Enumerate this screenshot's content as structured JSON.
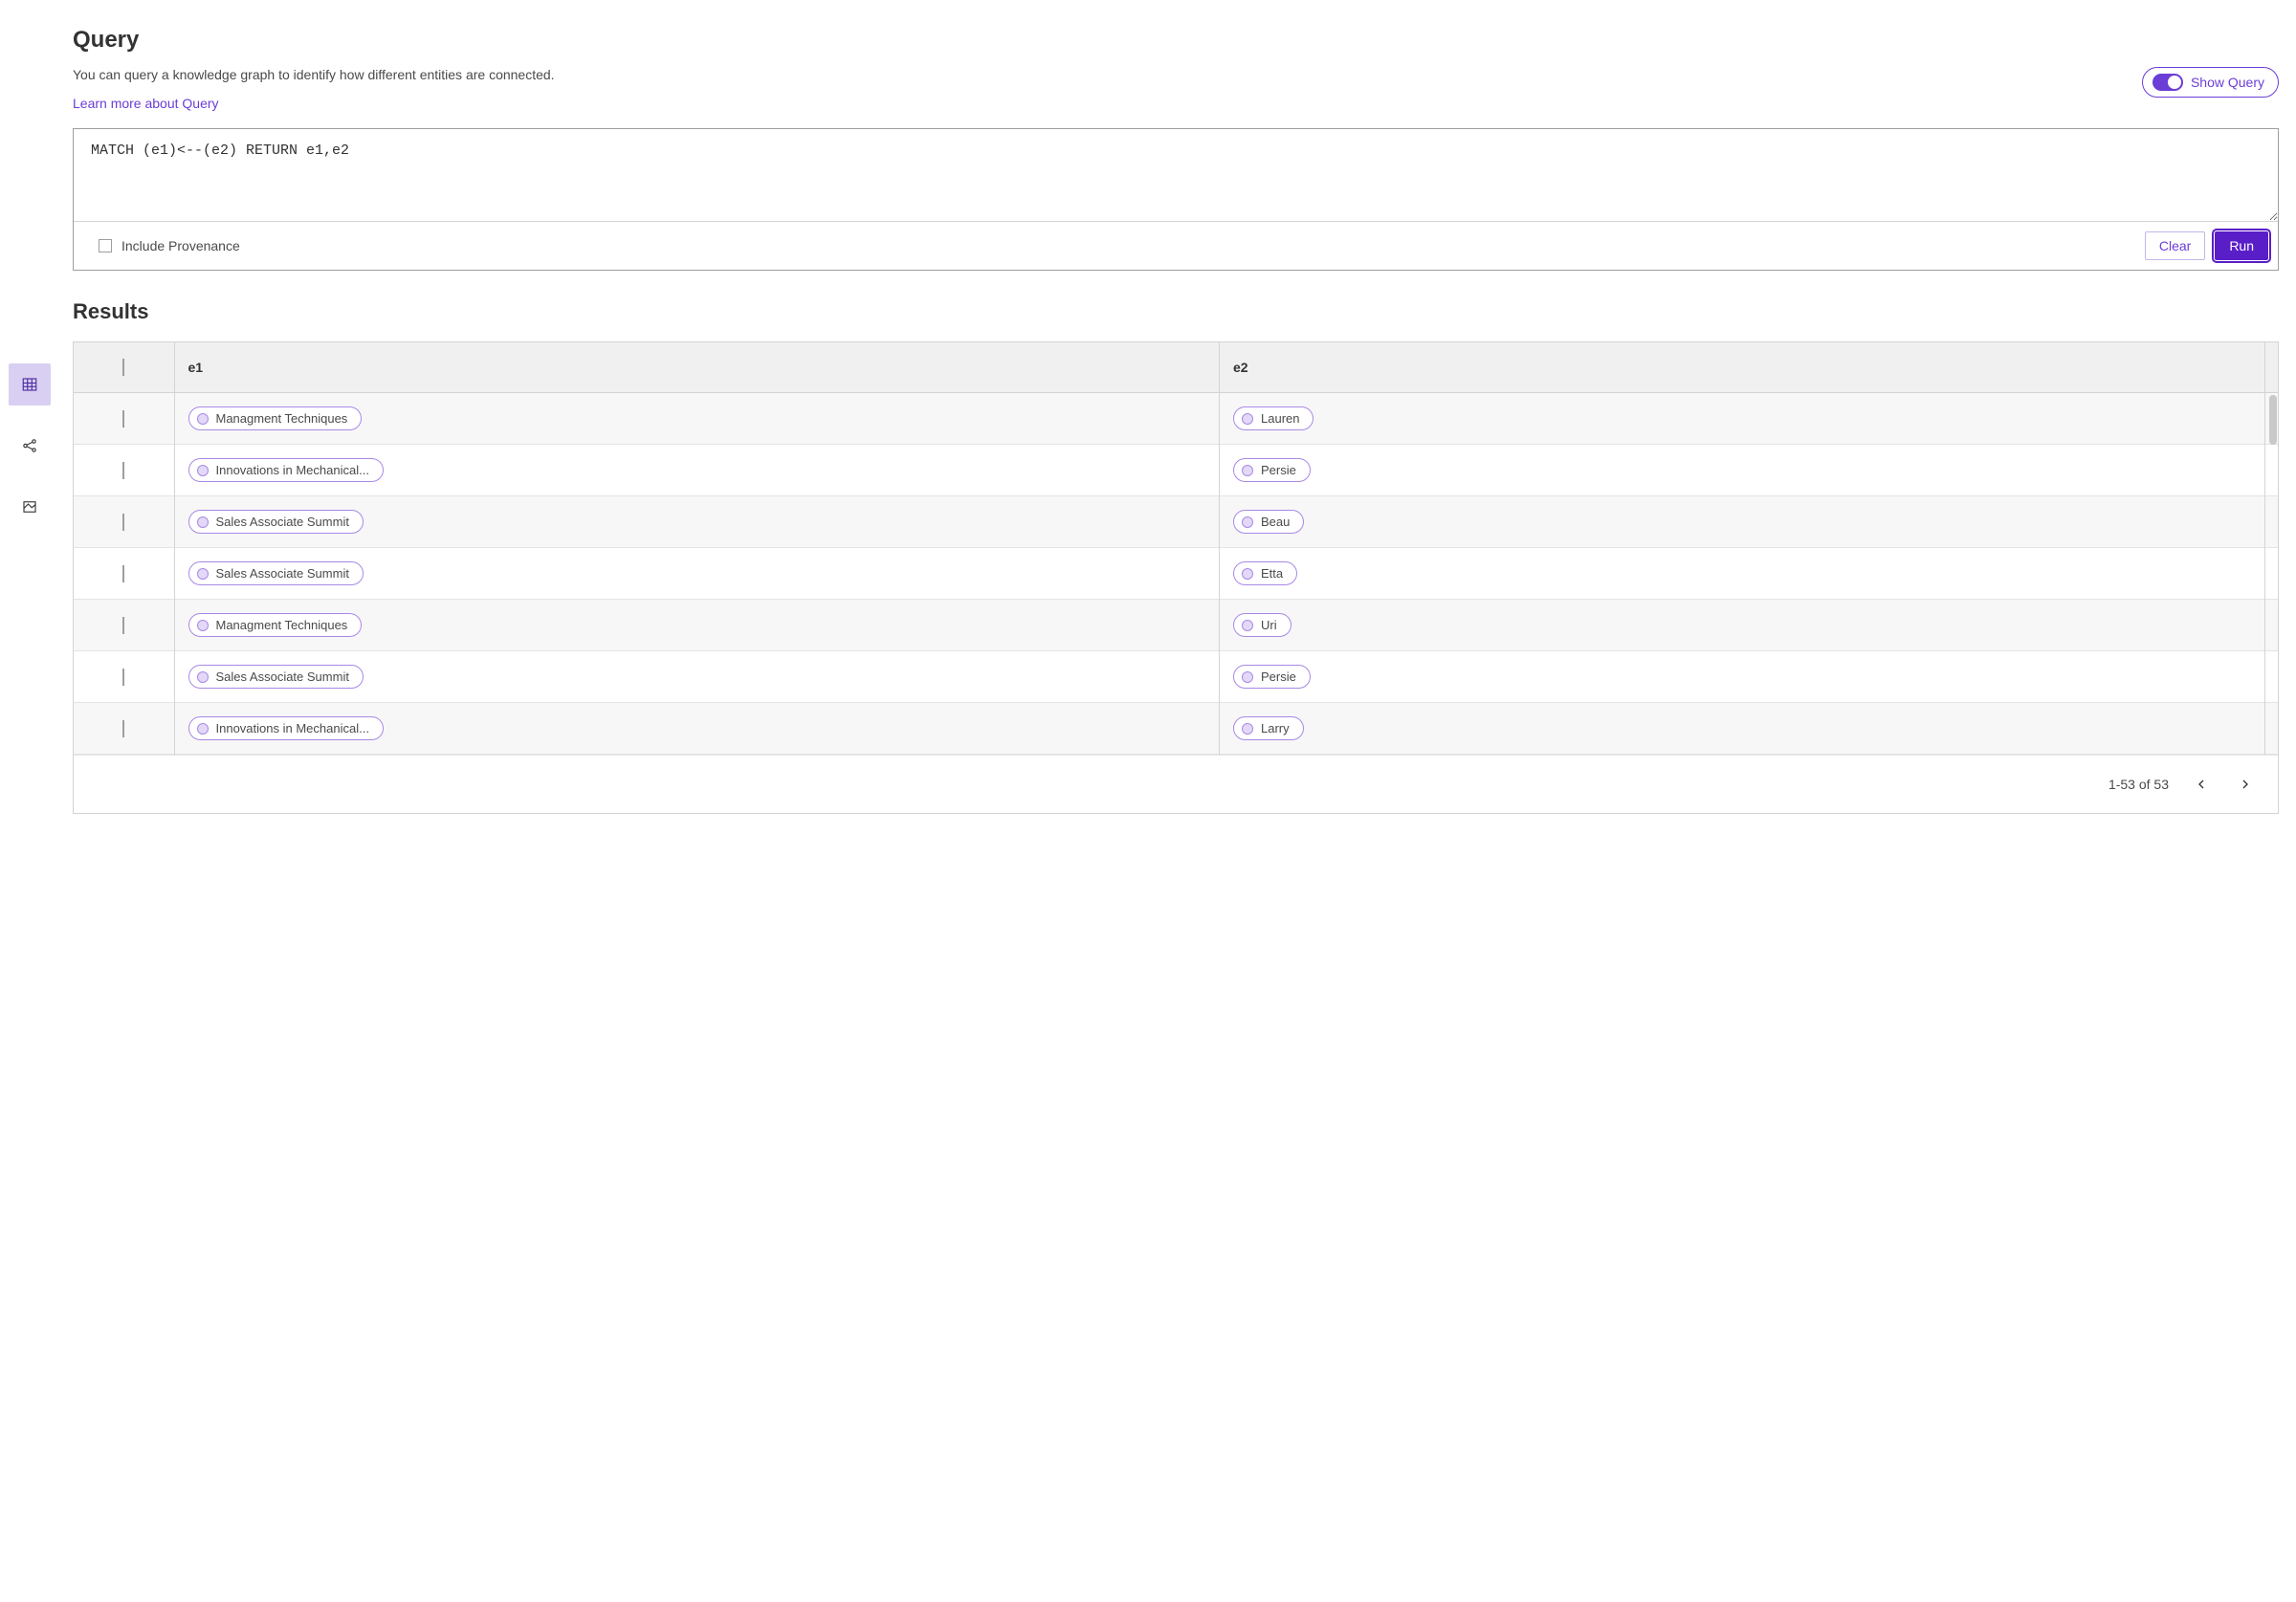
{
  "page": {
    "title": "Query",
    "subtitle": "You can query a knowledge graph to identify how different entities are connected.",
    "learn_link": "Learn more about Query",
    "show_query_label": "Show Query"
  },
  "query": {
    "text": "MATCH (e1)<--(e2) RETURN e1,e2",
    "include_provenance_label": "Include Provenance",
    "clear_label": "Clear",
    "run_label": "Run"
  },
  "results": {
    "title": "Results",
    "columns": [
      "e1",
      "e2"
    ],
    "rows": [
      {
        "e1": "Managment Techniques",
        "e2": "Lauren"
      },
      {
        "e1": "Innovations in Mechanical...",
        "e2": "Persie"
      },
      {
        "e1": "Sales Associate Summit",
        "e2": "Beau"
      },
      {
        "e1": "Sales Associate Summit",
        "e2": "Etta"
      },
      {
        "e1": "Managment Techniques",
        "e2": "Uri"
      },
      {
        "e1": "Sales Associate Summit",
        "e2": "Persie"
      },
      {
        "e1": "Innovations in Mechanical...",
        "e2": "Larry"
      }
    ],
    "pagination": "1-53 of 53"
  },
  "colors": {
    "accent": "#6b3ed6",
    "accent_dark": "#5a1ec8",
    "pill_border": "#a889e6"
  }
}
